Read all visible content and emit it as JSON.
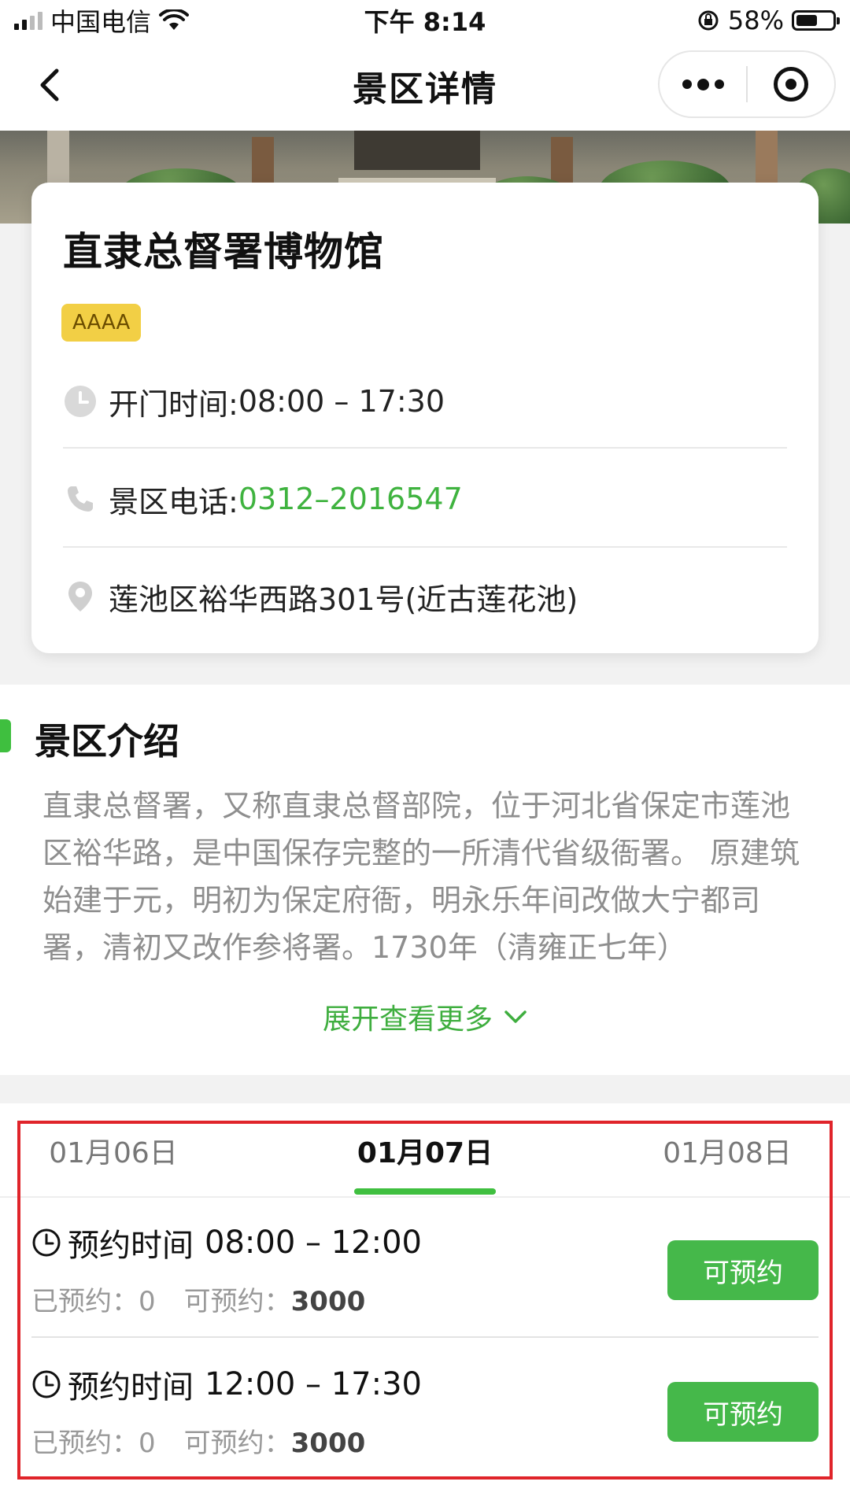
{
  "status_bar": {
    "carrier": "中国电信",
    "time": "下午 8:14",
    "battery_percent": "58%",
    "battery_level": 0.58
  },
  "nav": {
    "title": "景区详情",
    "back_icon": "chevron-left-icon",
    "more_icon": "more-dots-icon",
    "close_icon": "target-icon"
  },
  "spot": {
    "name": "直隶总督署博物馆",
    "level_badge": "AAAA",
    "open_time_label": "开门时间: ",
    "open_time_value": "08:00 – 17:30",
    "phone_label": "景区电话: ",
    "phone_value": "0312–2016547",
    "address": "莲池区裕华西路301号(近古莲花池)"
  },
  "intro": {
    "title": "景区介绍",
    "text": "直隶总督署，又称直隶总督部院，位于河北省保定市莲池区裕华路，是中国保存完整的一所清代省级衙署。 原建筑始建于元，明初为保定府衙，明永乐年间改做大宁都司署，清初又改作参将署。1730年（清雍正七年）",
    "expand_label": "展开查看更多"
  },
  "booking": {
    "dates": [
      "01月06日",
      "01月07日",
      "01月08日"
    ],
    "active_date_index": 1,
    "slots": [
      {
        "time_label": "预约时间",
        "time_range": "08:00 – 12:00",
        "booked_label": "已预约：",
        "booked_value": "0",
        "available_label": "可预约：",
        "available_value": "3000",
        "button_label": "可预约"
      },
      {
        "time_label": "预约时间",
        "time_range": "12:00 – 17:30",
        "booked_label": "已预约：",
        "booked_value": "0",
        "available_label": "可预约：",
        "available_value": "3000",
        "button_label": "可预约"
      }
    ]
  },
  "colors": {
    "accent_green": "#3fbf3f",
    "button_green": "#45b84a",
    "badge_yellow": "#f2cf45",
    "highlight_red": "#e0242a"
  }
}
